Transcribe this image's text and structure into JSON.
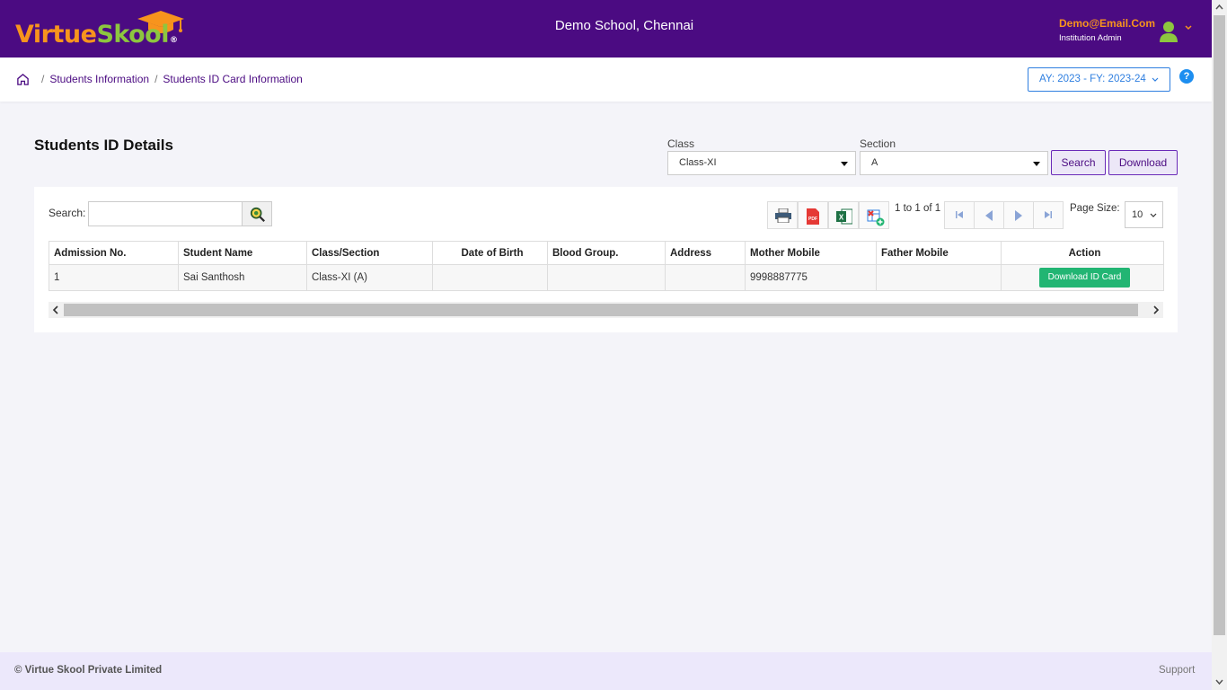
{
  "app": {
    "logo_part1": "Virtue",
    "logo_part2": "Skool",
    "logo_reg": "®",
    "school_name": "Demo School, Chennai",
    "user_email": "Demo@Email.Com",
    "user_role": "Institution Admin"
  },
  "breadcrumb": {
    "items": [
      "Students Information",
      "Students ID Card Information"
    ],
    "separator": "/"
  },
  "year_selector": "AY: 2023 - FY: 2023-24",
  "help_label": "?",
  "page_title": "Students ID Details",
  "filters": {
    "class_label": "Class",
    "class_value": "Class-XI",
    "section_label": "Section",
    "section_value": "A",
    "search_button": "Search",
    "download_button": "Download"
  },
  "grid": {
    "search_label": "Search:",
    "search_value": "",
    "pager_text": "1 to 1 of 1",
    "page_size_label": "Page Size:",
    "page_size_value": "10",
    "columns": [
      "Admission No.",
      "Student Name",
      "Class/Section",
      "Date of Birth",
      "Blood Group.",
      "Address",
      "Mother Mobile",
      "Father Mobile",
      "Action"
    ],
    "rows": [
      {
        "admission_no": "1",
        "student_name": "Sai Santhosh",
        "class_section": "Class-XI (A)",
        "dob": "",
        "blood_group": "",
        "address": "",
        "mother_mobile": "9998887775",
        "father_mobile": "",
        "action": "Download ID Card"
      }
    ]
  },
  "footer": {
    "copyright": "© Virtue Skool Private Limited",
    "support": "Support"
  },
  "colors": {
    "header_bg": "#4b0b82",
    "brand_orange": "#f7941d",
    "brand_green": "#8dc63f",
    "action_green": "#22b573",
    "link_blue": "#2f7fe0"
  }
}
